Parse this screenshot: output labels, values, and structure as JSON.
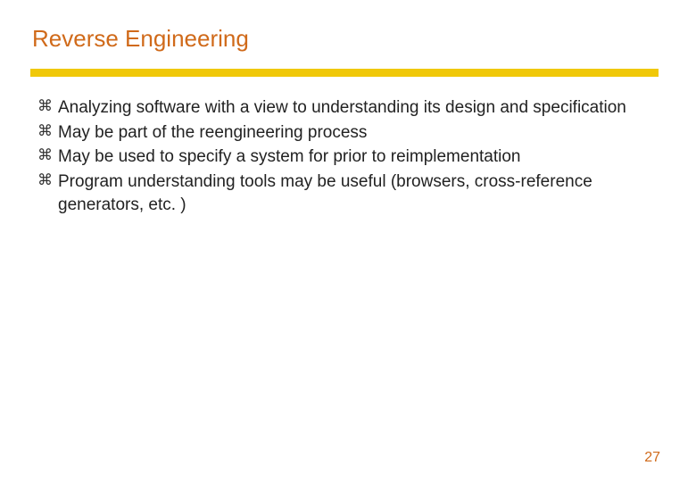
{
  "title": "Reverse Engineering",
  "bullets": [
    "Analyzing software with a view to understanding its design and specification",
    "May be part of the reengineering process",
    "May be used to specify a system for prior to reimplementation",
    "Program understanding tools may be useful (browsers, cross-reference generators, etc. )"
  ],
  "bullet_glyph": "⌘",
  "page_number": "27"
}
